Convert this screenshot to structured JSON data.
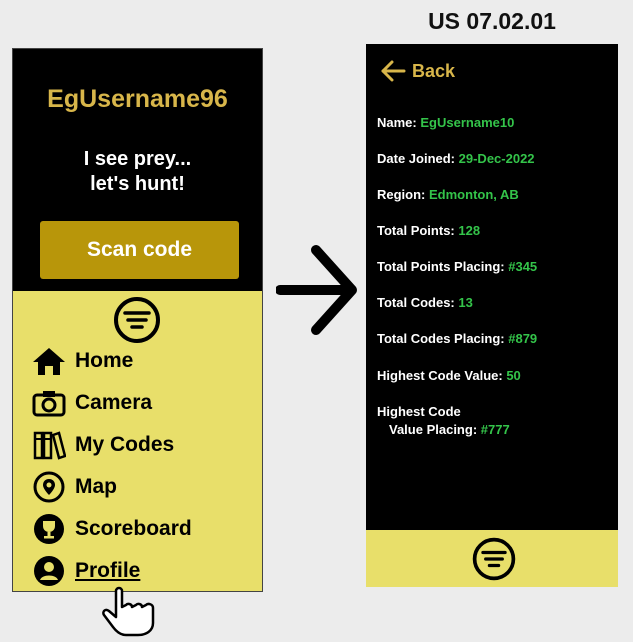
{
  "story_id": "US 07.02.01",
  "left_screen": {
    "username": "EgUsername96",
    "slogan_line1": "I see prey...",
    "slogan_line2": "let's hunt!",
    "scan_button": "Scan code",
    "menu_icon": "menu-lines-icon",
    "nav": [
      {
        "label": "Home",
        "icon": "home-icon"
      },
      {
        "label": "Camera",
        "icon": "camera-icon"
      },
      {
        "label": "My Codes",
        "icon": "books-icon"
      },
      {
        "label": "Map",
        "icon": "map-pin-icon"
      },
      {
        "label": "Scoreboard",
        "icon": "trophy-icon"
      },
      {
        "label": "Profile",
        "icon": "user-icon"
      }
    ],
    "pointer": "hand-pointer-icon"
  },
  "right_screen": {
    "back_label": "Back",
    "fields": [
      {
        "label": "Name:",
        "value": "EgUsername10"
      },
      {
        "label": "Date Joined:",
        "value": "29-Dec-2022"
      },
      {
        "label": "Region:",
        "value": "Edmonton, AB"
      },
      {
        "label": "Total Points:",
        "value": "128"
      },
      {
        "label": "Total Points Placing:",
        "value": "#345"
      },
      {
        "label": "Total Codes:",
        "value": "13"
      },
      {
        "label": "Total Codes Placing:",
        "value": "#879"
      },
      {
        "label": "Highest Code Value:",
        "value": "50"
      }
    ],
    "last_field": {
      "label_line1": "Highest Code",
      "label_line2": "Value Placing:",
      "value": "#777"
    },
    "menu_icon": "menu-lines-icon"
  },
  "colors": {
    "gold": "#d8b64a",
    "scan_button": "#b8960a",
    "yellow_panel": "#e8df6a",
    "value_green": "#34c44a"
  }
}
